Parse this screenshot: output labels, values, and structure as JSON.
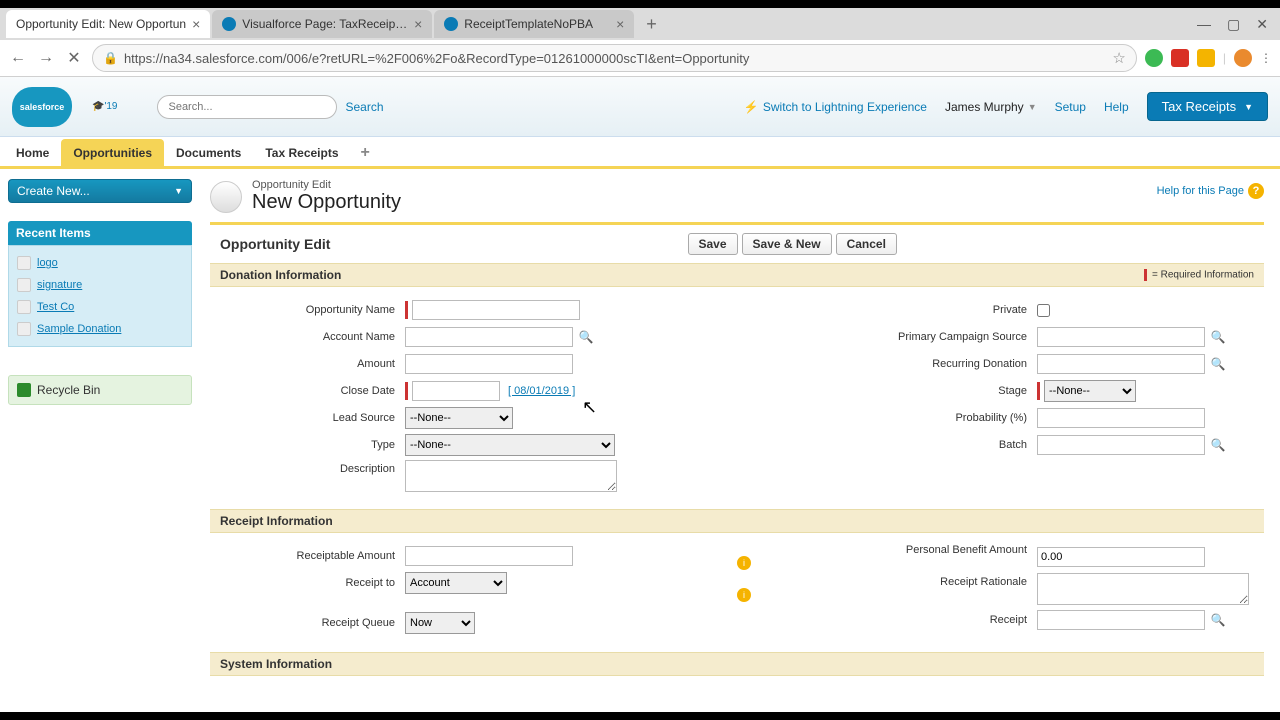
{
  "browser": {
    "tabs": [
      {
        "title": "Opportunity Edit: New Opportun"
      },
      {
        "title": "Visualforce Page: TaxReceiptsNP"
      },
      {
        "title": "ReceiptTemplateNoPBA"
      }
    ],
    "url": "https://na34.salesforce.com/006/e?retURL=%2F006%2Fo&RecordType=01261000000scTI&ent=Opportunity"
  },
  "header": {
    "logo_text": "salesforce",
    "search_placeholder": "Search...",
    "search_btn": "Search",
    "lightning": "Switch to Lightning Experience",
    "user": "James Murphy",
    "setup": "Setup",
    "help": "Help",
    "app": "Tax Receipts"
  },
  "nav": {
    "home": "Home",
    "opportunities": "Opportunities",
    "documents": "Documents",
    "tax_receipts": "Tax Receipts"
  },
  "sidebar": {
    "create_new": "Create New...",
    "recent_hdr": "Recent Items",
    "recent": [
      {
        "label": "logo"
      },
      {
        "label": "signature"
      },
      {
        "label": "Test Co"
      },
      {
        "label": "Sample Donation"
      }
    ],
    "recycle": "Recycle Bin"
  },
  "page": {
    "subtitle": "Opportunity Edit",
    "title": "New Opportunity",
    "help_link": "Help for this Page",
    "block_title": "Opportunity Edit",
    "save": "Save",
    "save_new": "Save & New",
    "cancel": "Cancel",
    "req_info": "= Required Information"
  },
  "sections": {
    "donation": "Donation Information",
    "receipt": "Receipt Information",
    "system": "System Information"
  },
  "fields": {
    "opp_name": "Opportunity Name",
    "account_name": "Account Name",
    "amount": "Amount",
    "close_date": "Close Date",
    "close_date_link": "[ 08/01/2019 ]",
    "lead_source": "Lead Source",
    "type": "Type",
    "description": "Description",
    "private": "Private",
    "primary_campaign": "Primary Campaign Source",
    "recurring": "Recurring Donation",
    "stage": "Stage",
    "probability": "Probability (%)",
    "batch": "Batch",
    "receiptable_amount": "Receiptable Amount",
    "receipt_to": "Receipt to",
    "receipt_queue": "Receipt Queue",
    "personal_benefit": "Personal Benefit Amount",
    "personal_benefit_value": "0.00",
    "receipt_rationale": "Receipt Rationale",
    "receipt": "Receipt"
  },
  "options": {
    "none": "--None--",
    "account": "Account",
    "now": "Now"
  }
}
